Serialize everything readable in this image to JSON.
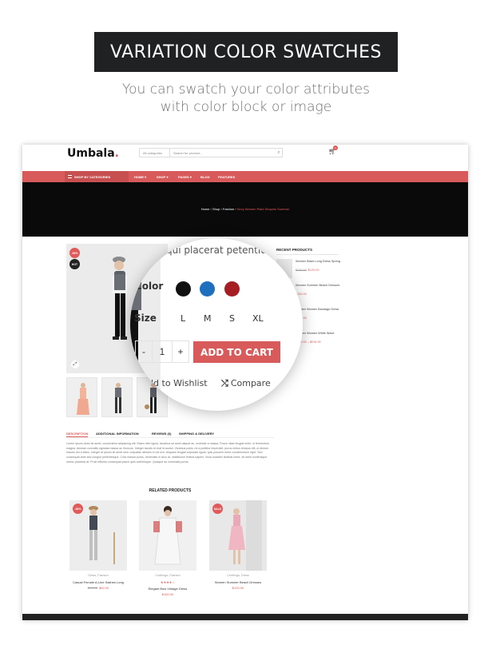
{
  "banner": {
    "title": "VARIATION COLOR SWATCHES",
    "subtitle_line1": "You can swatch  your color attributes",
    "subtitle_line2": "with color block or image"
  },
  "header": {
    "logo": "Umbala",
    "search_category": "All categories",
    "search_placeholder": "Search for product...",
    "cart_count": "0"
  },
  "nav": {
    "categories_label": "SHOP BY CATEGORIES",
    "items": [
      "HOME",
      "SHOP",
      "PAGES",
      "BLOG",
      "FEATURES"
    ]
  },
  "breadcrumb": {
    "home": "Home",
    "shop": "Shop",
    "fashion": "Fashion",
    "current": "Sexy Women Plaid Sequins Summer",
    "sep": "›"
  },
  "product": {
    "badge_sale": "-50%",
    "badge_hot": "HOT",
    "headline_partial": "qui placerat petentium.",
    "color_label": "Color",
    "colors": [
      "#111111",
      "#1f6fbf",
      "#a41e22"
    ],
    "size_label": "Size",
    "sizes": [
      "L",
      "M",
      "S",
      "XL"
    ],
    "qty_minus": "-",
    "qty_value": "1",
    "qty_plus": "+",
    "add_to_cart": "ADD TO CART",
    "wishlist": "ld to Wishlist",
    "compare": "Compare"
  },
  "tabs": {
    "description": "DESCRIPTION",
    "additional": "ADDITIONAL INFORMATION",
    "reviews": "REVIEWS (0)",
    "shipping": "SHIPPING & DELIVERY"
  },
  "description_text": "Lorem ipsum dolor sit amet, consectetur adipiscing elit. Etiam nibh ligula, faucibus sit amet aliquet ac, molestie a massa. Fusce vitae feugiat enim, in fermentum magna. Aenean convallis egestas massa ac rhoncus. Integer iaculis et erat id auctor. Vivamus porta, mi a porttitor imperdiet, purus metus tempus elit, ut dictum mauris dui a tellus. Integer at ipsum sit amet sem vulputate ultricies in vel orci. Aliquam feugiat vulputate ligula, quis posuere tortor condimentum eget. Sed consequat ante sed congue pellentesque. Cras massa purus, venenatis in arcu at, vestibulum finibus sapien. Nunc sodales facilisis tortor, sit amet scelerisque metus pharetra at. Proin efficitur consequat ipsum quis scelerisque. Quisque ac venenatis purus.",
  "related": {
    "title": "RELATED PRODUCTS",
    "items": [
      {
        "badge": "-50%",
        "category": "Dress, Fashion",
        "name": "Casual Female A-Line Sashes Long",
        "old_price": "$79.00",
        "price": "$60.00",
        "stars": ""
      },
      {
        "badge": "",
        "category": "Clothings, Fashion",
        "name": "Elegant Bow Vintage Dress",
        "old_price": "",
        "price": "$160.00",
        "stars": "★★★★☆"
      },
      {
        "badge": "SALE",
        "category": "Clothings, Dress",
        "name": "Women Summer Beach Dresses",
        "old_price": "",
        "price": "$120.00",
        "stars": ""
      }
    ]
  },
  "recent": {
    "title": "RECENT PRODUCTS",
    "items": [
      {
        "name": "Women Black Long Dress Spring",
        "old_price": "$150.00",
        "price": "$120.00"
      },
      {
        "name": "Women Summer Beach Dresses",
        "old_price": "",
        "price": "$120.00"
      },
      {
        "name": "Women Women Bandage Dress",
        "old_price": "",
        "price": "$120.00"
      },
      {
        "name": "Women Women White Wave",
        "old_price": "",
        "price": "$130.00 – $215.00"
      }
    ]
  },
  "colors": {
    "accent": "#d95a5a",
    "dark": "#1f2122"
  }
}
